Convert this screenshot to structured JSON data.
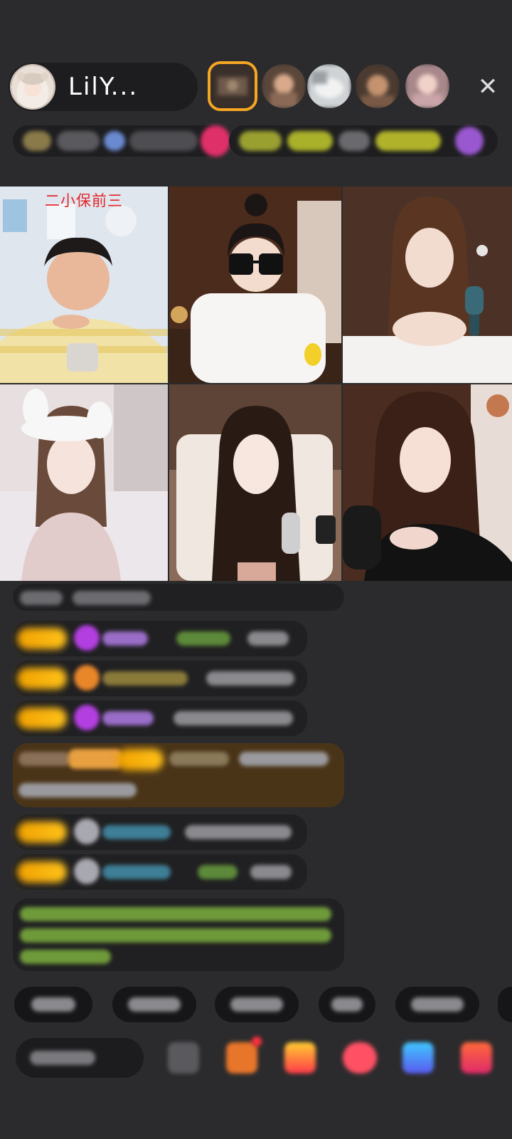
{
  "host": {
    "name": "LilY..."
  },
  "header": {
    "close_symbol": "✕",
    "viewers": [
      "viewer-avatar-1",
      "viewer-avatar-2",
      "viewer-avatar-3",
      "viewer-avatar-4",
      "viewer-avatar-5"
    ]
  },
  "grid": {
    "cell_1_caption": "二小保前三"
  },
  "colors": {
    "background": "#2b2b2d",
    "badge_gold": "#f5a623",
    "caption_red": "#e3262a",
    "chat_green": "#8bc34a",
    "chat_blue": "#4aa3c9",
    "highlight_brown": "#5a3d1e"
  },
  "icons": {
    "close": "close-icon",
    "emoji": "emoji-icon",
    "gift": "gift-icon",
    "shop": "shop-icon",
    "game": "game-icon",
    "chat": "chat-icon",
    "grid": "grid-icon"
  }
}
